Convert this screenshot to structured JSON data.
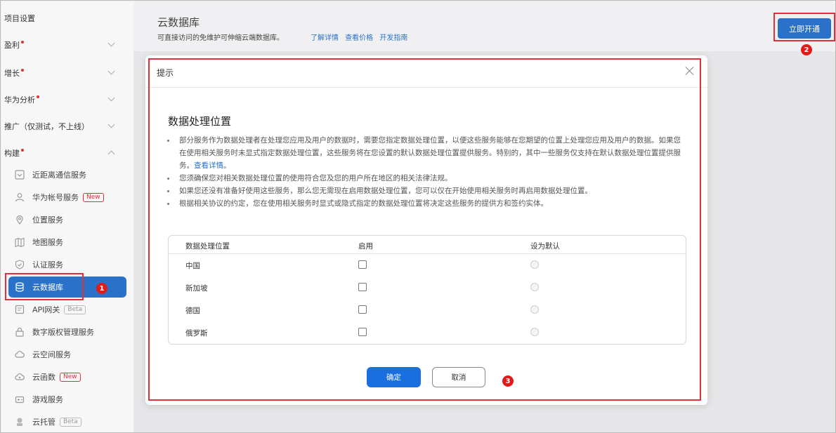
{
  "sidebar": {
    "sections": [
      {
        "label": "项目设置",
        "required": false
      },
      {
        "label": "盈利",
        "required": true
      },
      {
        "label": "增长",
        "required": true
      },
      {
        "label": "华为分析",
        "required": true
      },
      {
        "label": "推广（仅测试，不上线）",
        "required": false
      },
      {
        "label": "构建",
        "required": true
      }
    ],
    "items": [
      {
        "label": "近距离通信服务",
        "badge": "",
        "icon": "nearby-icon"
      },
      {
        "label": "华为帐号服务",
        "badge": "New",
        "icon": "user-icon"
      },
      {
        "label": "位置服务",
        "badge": "",
        "icon": "location-icon"
      },
      {
        "label": "地图服务",
        "badge": "",
        "icon": "map-icon"
      },
      {
        "label": "认证服务",
        "badge": "",
        "icon": "shield-icon"
      },
      {
        "label": "云数据库",
        "badge": "",
        "icon": "database-icon",
        "active": true
      },
      {
        "label": "API网关",
        "badge": "Beta",
        "icon": "api-gateway-icon"
      },
      {
        "label": "数字版权管理服务",
        "badge": "",
        "icon": "drm-icon"
      },
      {
        "label": "云空间服务",
        "badge": "",
        "icon": "cloud-space-icon"
      },
      {
        "label": "云函数",
        "badge": "New",
        "icon": "cloud-function-icon"
      },
      {
        "label": "游戏服务",
        "badge": "",
        "icon": "game-icon"
      },
      {
        "label": "云托管",
        "badge": "Beta",
        "icon": "cloud-hosting-icon"
      }
    ]
  },
  "header": {
    "title": "云数据库",
    "description": "可直接访问的免维护可伸缩云端数据库。",
    "links": [
      "了解详情",
      "查看价格",
      "开发指南"
    ],
    "open_button": "立即开通"
  },
  "dialog": {
    "title": "提示",
    "section_title": "数据处理位置",
    "bullets": [
      {
        "text": "部分服务作为数据处理者在处理您应用及用户的数据时，需要您指定数据处理位置，以便这些服务能够在您期望的位置上处理您应用及用户的数据。如果您在使用相关服务时未显式指定数据处理位置，这些服务将在您设置的默认数据处理位置提供服务。特别的，其中一些服务仅支持在默认数据处理位置提供服务。",
        "link": "查看详情",
        "suffix": "。"
      },
      {
        "text": "您须确保您对相关数据处理位置的使用符合您及您的用户所在地区的相关法律法规。"
      },
      {
        "text": "如果您还没有准备好使用这些服务，那么您无需现在启用数据处理位置，您可以仅在开始使用相关服务时再启用数据处理位置。"
      },
      {
        "text": "根据相关协议的约定，您在使用相关服务时显式或隐式指定的数据处理位置将决定这些服务的提供方和签约实体。"
      }
    ],
    "table": {
      "headers": [
        "数据处理位置",
        "启用",
        "设为默认"
      ],
      "rows": [
        {
          "location": "中国",
          "enabled": false,
          "default": false
        },
        {
          "location": "新加坡",
          "enabled": false,
          "default": false
        },
        {
          "location": "德国",
          "enabled": false,
          "default": false
        },
        {
          "location": "俄罗斯",
          "enabled": false,
          "default": false
        }
      ]
    },
    "ok_button": "确定",
    "cancel_button": "取消"
  },
  "annotations": [
    "1",
    "2",
    "3"
  ]
}
